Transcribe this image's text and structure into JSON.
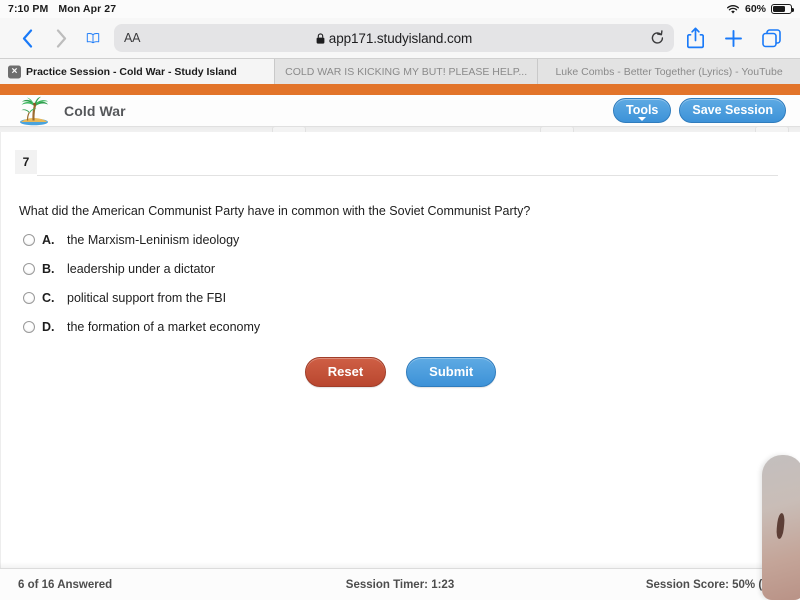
{
  "status_bar": {
    "time": "7:10 PM",
    "date": "Mon Apr 27",
    "wifi_icon": "wifi-icon",
    "battery_percent": "60%",
    "battery_level": 60
  },
  "browser": {
    "back_icon": "chevron-left-icon",
    "forward_icon": "chevron-right-icon",
    "bookmarks_icon": "book-icon",
    "text_size_label": "AA",
    "lock_icon": "lock-icon",
    "url": "app171.studyisland.com",
    "reload_icon": "reload-icon",
    "share_icon": "share-icon",
    "new_tab_icon": "plus-icon",
    "show_tabs_icon": "tabs-overview-icon",
    "tabs": [
      {
        "title": "Practice Session - Cold War - Study Island",
        "active": true,
        "close_icon": "close-icon"
      },
      {
        "title": "COLD WAR IS KICKING MY BUT! PLEASE HELP...",
        "active": false
      },
      {
        "title": "Luke Combs - Better Together (Lyrics) - YouTube",
        "active": false
      }
    ]
  },
  "app": {
    "brand_color": "#e2742a",
    "accent_blue": "#3d92d8",
    "accent_red": "#b9472f",
    "logo_icon": "palm-tree-island-logo",
    "title": "Cold War",
    "tools_button": "Tools",
    "tools_caret_icon": "caret-down-icon",
    "save_session_button": "Save Session"
  },
  "question": {
    "number": "7",
    "text": "What did the American Communist Party have in common with the Soviet Communist Party?",
    "options": [
      {
        "letter": "A.",
        "text": "the Marxism-Leninism ideology",
        "selected": false
      },
      {
        "letter": "B.",
        "text": "leadership under a dictator",
        "selected": false
      },
      {
        "letter": "C.",
        "text": "political support from the FBI",
        "selected": false
      },
      {
        "letter": "D.",
        "text": "the formation of a market economy",
        "selected": false
      }
    ],
    "reset_button": "Reset",
    "submit_button": "Submit"
  },
  "footer": {
    "answered": "6 of 16 Answered",
    "timer": "Session Timer: 1:23",
    "score": "Session Score: 50% (3/6)"
  },
  "overlay": {
    "thumb": "finger-thumb-overlay"
  }
}
